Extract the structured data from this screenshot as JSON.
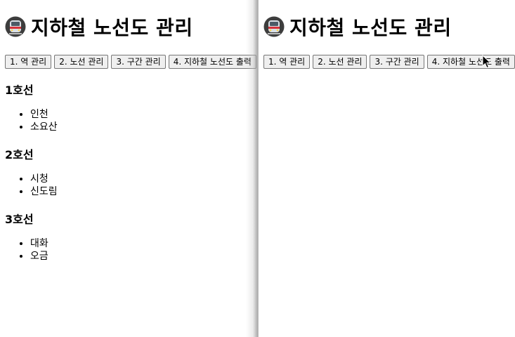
{
  "left_pane": {
    "title": "지하철 노선도 관리",
    "buttons": [
      "1. 역 관리",
      "2. 노선 관리",
      "3. 구간 관리",
      "4. 지하철 노선도 출력"
    ],
    "lines": [
      {
        "name": "1호선",
        "stations": [
          "인천",
          "소요산"
        ]
      },
      {
        "name": "2호선",
        "stations": [
          "시청",
          "신도림"
        ]
      },
      {
        "name": "3호선",
        "stations": [
          "대화",
          "오금"
        ]
      }
    ]
  },
  "right_pane": {
    "title": "지하철 노선도 관리",
    "buttons": [
      "1. 역 관리",
      "2. 노선 관리",
      "3. 구간 관리",
      "4. 지하철 노선도 출력"
    ]
  },
  "icons": {
    "title_icon": "metro-train-icon",
    "cursor": "mouse-pointer-icon"
  },
  "colors": {
    "train_body": "#444444",
    "train_front": "#d9e0e6",
    "train_stripe": "#d6323a"
  }
}
